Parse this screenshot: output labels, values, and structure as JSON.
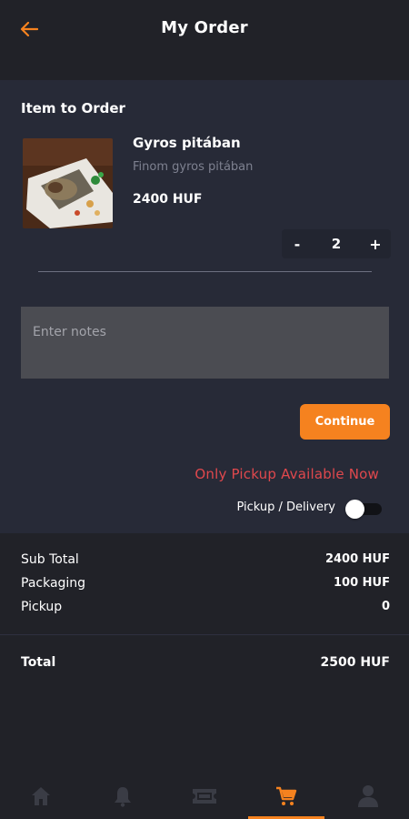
{
  "header": {
    "title": "My Order",
    "back_icon": "arrow-left-icon"
  },
  "order": {
    "section_title": "Item to Order",
    "item": {
      "name": "Gyros pitában",
      "description": "Finom gyros pitában",
      "price": "2400 HUF",
      "image": "gyros-photo"
    },
    "quantity": "2",
    "decrement_label": "-",
    "increment_label": "+",
    "notes_placeholder": "Enter notes",
    "continue_label": "Continue",
    "pickup_notice": "Only Pickup Available Now",
    "toggle_label": "Pickup / Delivery",
    "toggle_on": false
  },
  "summary": {
    "rows": [
      {
        "label": "Sub Total",
        "value": "2400 HUF"
      },
      {
        "label": "Packaging",
        "value": "100 HUF"
      },
      {
        "label": "Pickup",
        "value": "0"
      }
    ],
    "total_label": "Total",
    "total_value": "2500 HUF"
  },
  "nav": {
    "items": [
      {
        "icon": "home-icon",
        "active": false
      },
      {
        "icon": "bell-icon",
        "active": false
      },
      {
        "icon": "ticket-icon",
        "active": false
      },
      {
        "icon": "cart-icon",
        "active": true
      },
      {
        "icon": "user-icon",
        "active": false
      }
    ]
  },
  "colors": {
    "accent": "#f5821f",
    "background": "#212228",
    "panel": "#272a37",
    "warning": "#e0484d",
    "inactive_icon": "#3a3c45"
  }
}
